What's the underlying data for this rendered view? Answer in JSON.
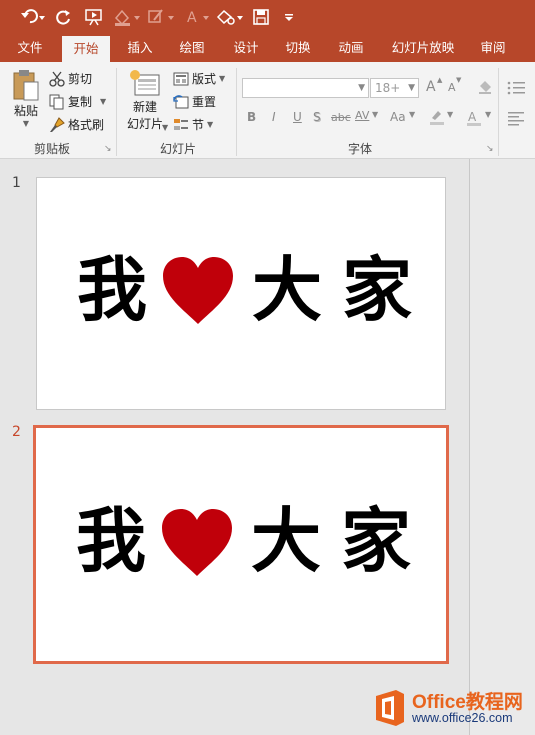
{
  "tabs": [
    {
      "label": "文件",
      "active": false
    },
    {
      "label": "开始",
      "active": true
    },
    {
      "label": "插入",
      "active": false
    },
    {
      "label": "绘图",
      "active": false
    },
    {
      "label": "设计",
      "active": false
    },
    {
      "label": "切换",
      "active": false
    },
    {
      "label": "动画",
      "active": false
    },
    {
      "label": "幻灯片放映",
      "active": false
    },
    {
      "label": "审阅",
      "active": false
    }
  ],
  "clipboard": {
    "paste_label": "粘贴",
    "cut_label": "剪切",
    "copy_label": "复制",
    "format_painter_label": "格式刷",
    "group_label": "剪贴板"
  },
  "slides_group": {
    "new_slide_line1": "新建",
    "new_slide_line2": "幻灯片",
    "layout_label": "版式",
    "reset_label": "重置",
    "section_label": "节",
    "group_label": "幻灯片"
  },
  "font_group": {
    "font_name": "",
    "font_size_placeholder": "18+",
    "group_label": "字体",
    "bold": "B",
    "italic": "I",
    "underline": "U",
    "shadow": "S",
    "strike": "abc",
    "spacing": "AV",
    "case": "Aa",
    "grow": "A",
    "shrink": "A"
  },
  "slide_panel": {
    "slides": [
      {
        "number": "1",
        "chars": [
          "我",
          "大",
          "家"
        ],
        "selected": false
      },
      {
        "number": "2",
        "chars": [
          "我",
          "大",
          "家"
        ],
        "selected": true
      }
    ]
  },
  "watermark": {
    "brand": "Office教程网",
    "url": "www.office26.com"
  },
  "colors": {
    "accent": "#b7472a",
    "selection": "#e0694a",
    "heart": "#c0000a"
  }
}
